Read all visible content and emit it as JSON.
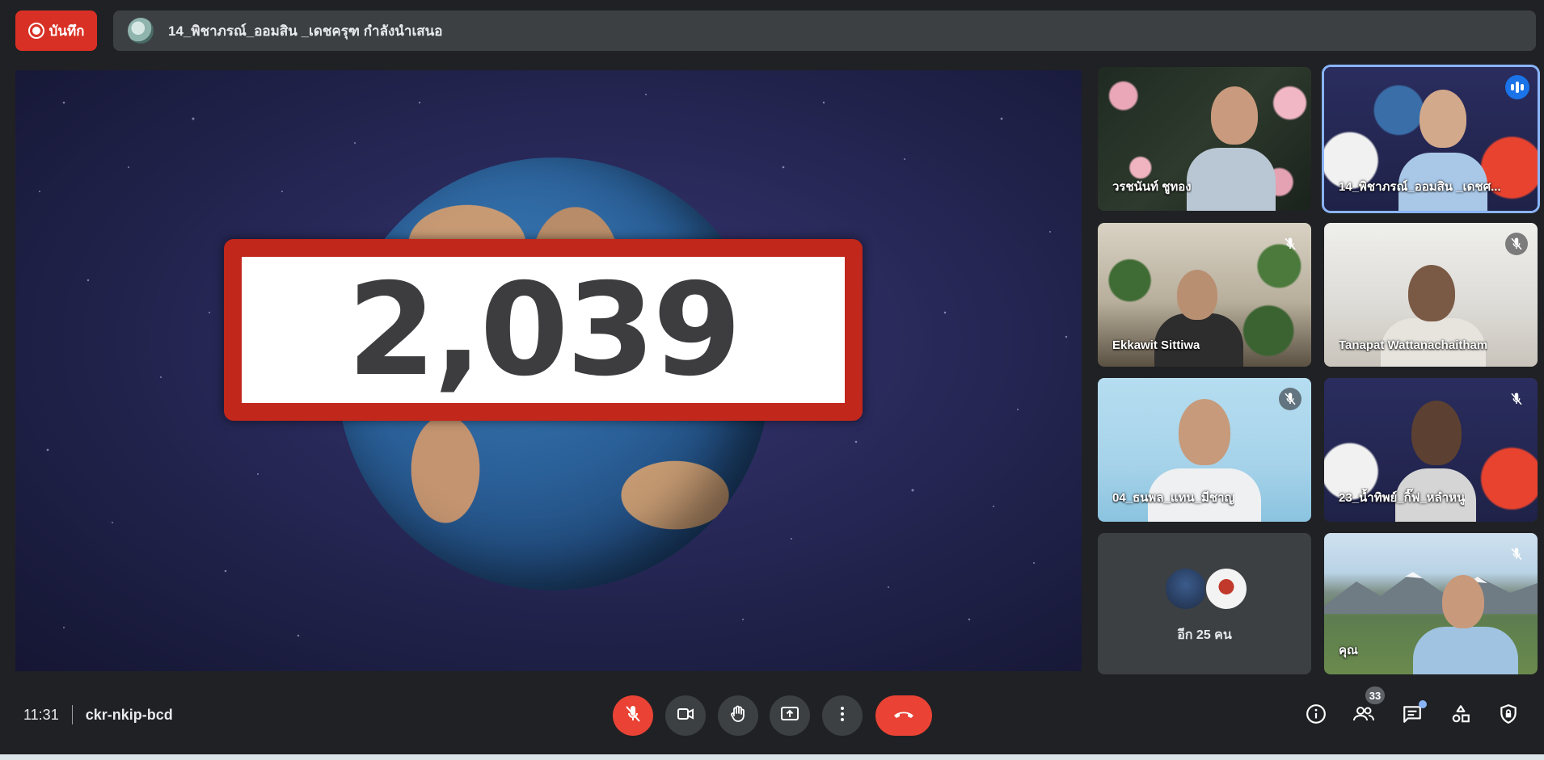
{
  "recording": {
    "label": "บันทึก"
  },
  "presenter_bar": {
    "text": "14_พิชาภรณ์_ออมสิน _เดชครุฑ กำลังนำเสนอ"
  },
  "presentation": {
    "counter": "2,039"
  },
  "participants": [
    {
      "name": "วรชนันท์ ชูทอง",
      "muted": false,
      "speaking": false
    },
    {
      "name": "14_พิชาภรณ์_ออมสิน _เดชศ...",
      "muted": false,
      "speaking": true
    },
    {
      "name": "Ekkawit Sittiwa",
      "muted": true,
      "speaking": false
    },
    {
      "name": "Tanapat Wattanachaitham",
      "muted": true,
      "speaking": false
    },
    {
      "name": "04_ธนพล_แทน_มีชาญ",
      "muted": true,
      "speaking": false
    },
    {
      "name": "23_น้ำทิพย์_กิ๊ฟ_หลำหนู",
      "muted": true,
      "speaking": false
    },
    {
      "name": "คุณ",
      "muted": true,
      "speaking": false
    }
  ],
  "more_participants": {
    "label": "อีก 25 คน"
  },
  "meeting": {
    "time": "11:31",
    "code": "ckr-nkip-bcd"
  },
  "controls": {
    "mic": "mic-off-icon",
    "camera": "camera-icon",
    "raise_hand": "hand-icon",
    "present": "present-screen-icon",
    "more": "more-vert-icon",
    "end_call": "end-call-icon"
  },
  "side_controls": {
    "people_count": "33"
  },
  "colors": {
    "record_red": "#d93025",
    "end_call_red": "#ea4335",
    "active_border": "#8ab4f8",
    "bar_bg": "#3c4043",
    "app_bg": "#202124"
  }
}
